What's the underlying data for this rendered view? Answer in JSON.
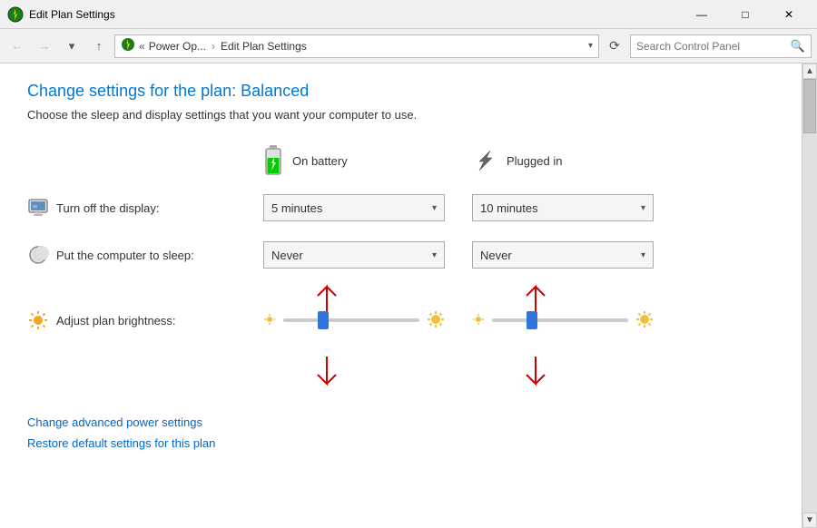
{
  "titleBar": {
    "icon": "⚡",
    "title": "Edit Plan Settings",
    "minimizeLabel": "—",
    "maximizeLabel": "□",
    "closeLabel": "✕"
  },
  "navBar": {
    "backLabel": "←",
    "forwardLabel": "→",
    "dropdownLabel": "▾",
    "upLabel": "↑",
    "breadcrumb": {
      "icon": "⚡",
      "items": [
        "Power Op...",
        "Edit Plan Settings"
      ]
    },
    "addressChevron": "▾",
    "refreshLabel": "⟳",
    "searchPlaceholder": "Search Control Panel",
    "searchIcon": "🔍"
  },
  "page": {
    "title": "Change settings for the plan: Balanced",
    "subtitle": "Choose the sleep and display settings that you want your computer to use.",
    "columnHeaders": {
      "battery": "On battery",
      "plugged": "Plugged in"
    }
  },
  "settings": {
    "display": {
      "label": "Turn off the display:",
      "batteryValue": "5 minutes",
      "pluggedValue": "10 minutes"
    },
    "sleep": {
      "label": "Put the computer to sleep:",
      "batteryValue": "Never",
      "pluggedValue": "Never"
    },
    "brightness": {
      "label": "Adjust plan brightness:"
    }
  },
  "links": {
    "advanced": "Change advanced power settings",
    "restore": "Restore default settings for this plan"
  },
  "dropdowns": {
    "arrow": "▾"
  }
}
